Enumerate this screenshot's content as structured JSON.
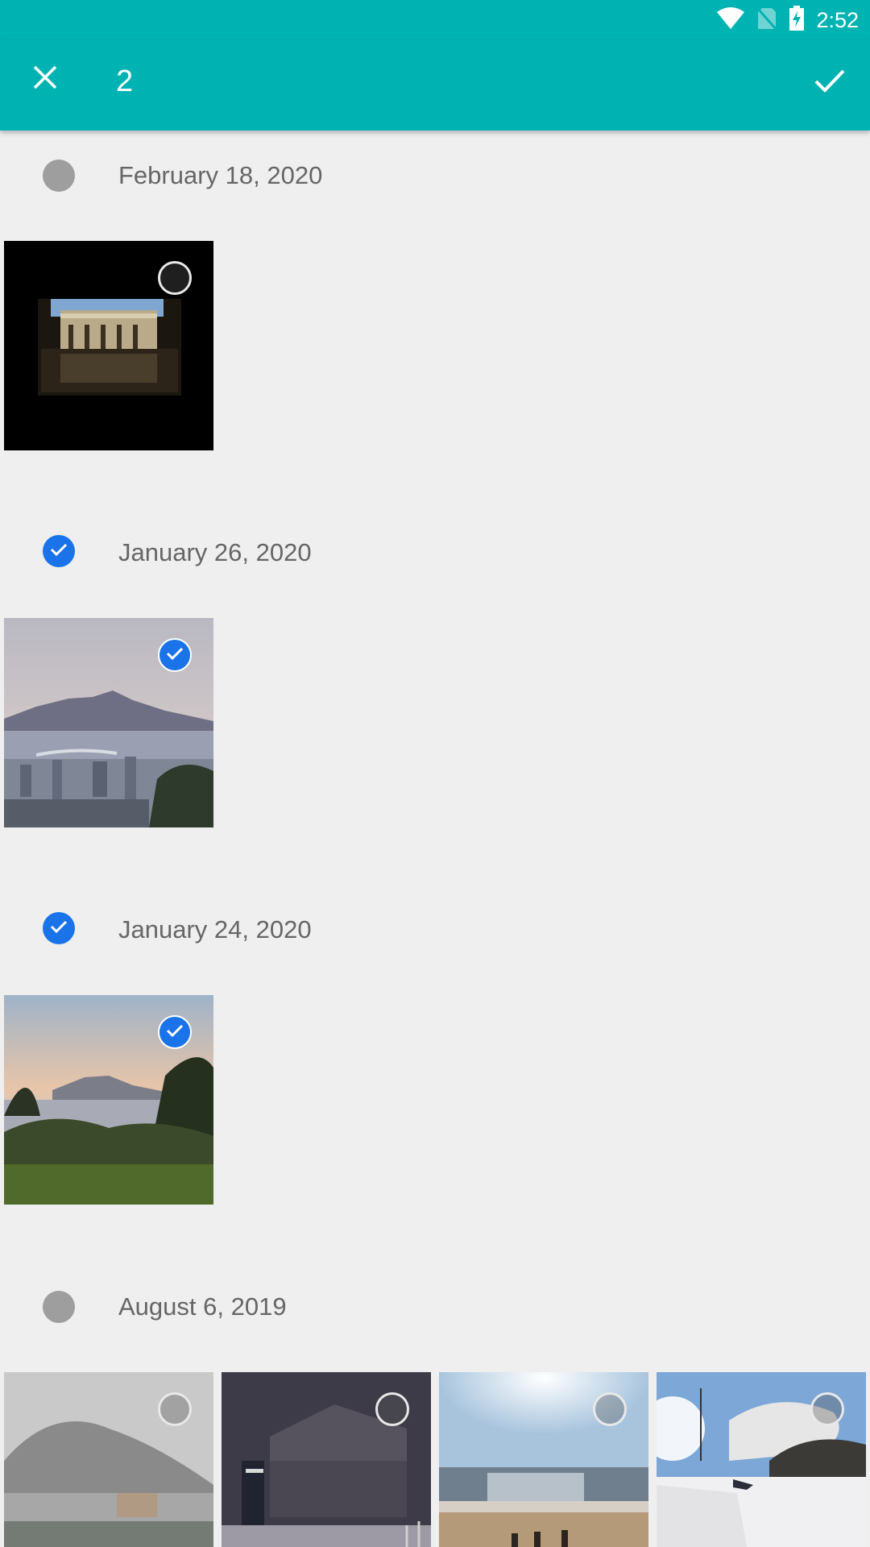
{
  "status_bar": {
    "time": "2:52",
    "icons": [
      "wifi-icon",
      "no-sim-icon",
      "battery-charging-icon"
    ]
  },
  "app_bar": {
    "selected_count": "2",
    "close_icon": "close-icon",
    "confirm_icon": "check-icon"
  },
  "accent_color": "#00b3b3",
  "selection_color": "#1a73e8",
  "sections": [
    {
      "date": "February 18, 2020",
      "selected": false,
      "photos": [
        {
          "subject": "building-courtyard",
          "selected": false
        }
      ]
    },
    {
      "date": "January 26, 2020",
      "selected": true,
      "photos": [
        {
          "subject": "mountain-city-view",
          "selected": true
        }
      ]
    },
    {
      "date": "January 24, 2020",
      "selected": true,
      "photos": [
        {
          "subject": "sunset-hill-view",
          "selected": true
        }
      ]
    },
    {
      "date": "August 6, 2019",
      "selected": false,
      "photos": [
        {
          "subject": "misty-mountain",
          "selected": false
        },
        {
          "subject": "snowy-night-hut",
          "selected": false
        },
        {
          "subject": "beach-sunlight",
          "selected": false
        },
        {
          "subject": "ski-slope",
          "selected": false
        }
      ]
    }
  ]
}
